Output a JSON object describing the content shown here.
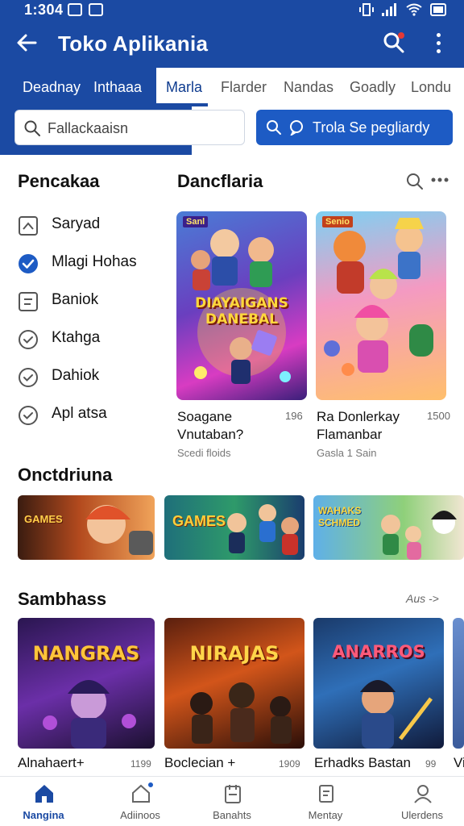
{
  "status_bar": {
    "time": "1:304"
  },
  "app_bar": {
    "title": "Toko Aplikania"
  },
  "tabs": [
    {
      "label": "Deadnay"
    },
    {
      "label": "Inthaaa"
    },
    {
      "label": "Marla"
    },
    {
      "label": "Flarder"
    },
    {
      "label": "Nandas"
    },
    {
      "label": "Goadly"
    },
    {
      "label": "Londu"
    }
  ],
  "search": {
    "placeholder": "Fallackaaisn"
  },
  "cta_button": {
    "label": "Trola Se pegliardy"
  },
  "categories": {
    "title": "Pencakaa",
    "items": [
      {
        "label": "Saryad",
        "icon": "image-icon"
      },
      {
        "label": "Mlagi Hohas",
        "icon": "check-circle-filled-icon",
        "selected": true
      },
      {
        "label": "Baniok",
        "icon": "document-icon"
      },
      {
        "label": "Ktahga",
        "icon": "check-circle-icon"
      },
      {
        "label": "Dahiok",
        "icon": "check-circle-icon"
      },
      {
        "label": "Apl atsa",
        "icon": "check-circle-icon"
      }
    ]
  },
  "featured": {
    "title": "Dancflaria",
    "cards": [
      {
        "art_text": "DIAYAIGANS DANEBAL",
        "badge": "Sanl",
        "name": "Soagane Vnutaban?",
        "count": "196",
        "sub": "Scedi floids"
      },
      {
        "art_text": "",
        "badge": "Senio",
        "name": "Ra Donlerkay Flamanbar",
        "count": "1500",
        "sub": "Gasla 1 Sain"
      }
    ]
  },
  "banners": {
    "title": "Onctdriuna",
    "items": [
      {
        "art_text": "GAMES"
      },
      {
        "art_text": "GAMES"
      },
      {
        "art_text": "WAHAKS SCHMED"
      }
    ]
  },
  "games": {
    "title": "Sambhass",
    "see_all": "Aus ->",
    "items": [
      {
        "art_text": "NANGRAS",
        "name": "Alnahaert+",
        "count": "1199"
      },
      {
        "art_text": "NIRAJAS",
        "name": "Boclecian +",
        "count": "1909"
      },
      {
        "art_text": "ANARROS",
        "name": "Erhadks Bastan",
        "count": "99"
      },
      {
        "name": "Vi"
      }
    ]
  },
  "bottom_nav": [
    {
      "label": "Nangina",
      "icon": "home-icon",
      "active": true
    },
    {
      "label": "Adiinoos",
      "icon": "updates-icon"
    },
    {
      "label": "Banahts",
      "icon": "library-icon"
    },
    {
      "label": "Mentay",
      "icon": "book-icon"
    },
    {
      "label": "Ulerdens",
      "icon": "profile-icon"
    }
  ],
  "colors": {
    "primary": "#1b4aa3",
    "accent": "#1d5bc4"
  }
}
